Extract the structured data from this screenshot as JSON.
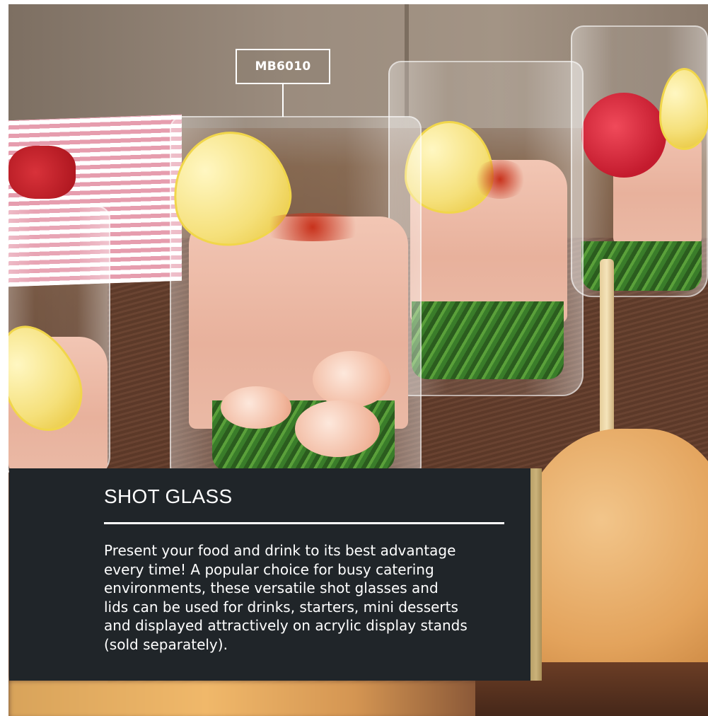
{
  "product_code": "MB6010",
  "title": "SHOT GLASS",
  "description_lines": [
    "Present your food and drink to its best advantage",
    "every time! A popular choice for busy catering",
    "environments, these versatile shot glasses and",
    "lids can be used for drinks, starters, mini desserts",
    "and displayed attractively on acrylic display stands",
    "(sold separately)."
  ],
  "colors": {
    "panel_background": "#202529",
    "panel_accent": "#b8a067",
    "text": "#ffffff"
  }
}
